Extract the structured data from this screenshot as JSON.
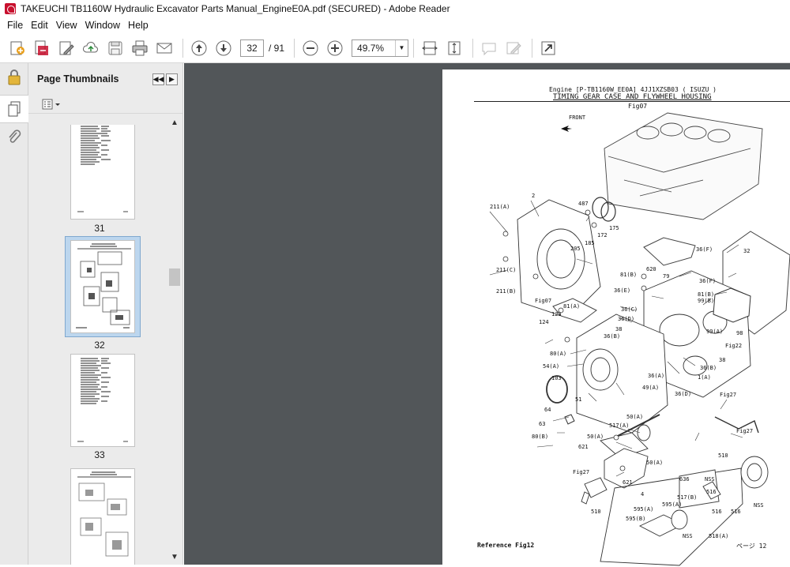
{
  "window": {
    "title": "TAKEUCHI TB1160W Hydraulic Excavator Parts Manual_EngineE0A.pdf (SECURED) - Adobe Reader",
    "app_icon": "adobe-reader-icon"
  },
  "menu": [
    "File",
    "Edit",
    "View",
    "Window",
    "Help"
  ],
  "toolbar": {
    "current_page": "32",
    "total_pages": "/ 91",
    "zoom": "49.7%"
  },
  "sidebar": {
    "panel_title": "Page Thumbnails",
    "thumbnails": [
      {
        "label": "31",
        "selected": false
      },
      {
        "label": "32",
        "selected": true
      },
      {
        "label": "33",
        "selected": false
      },
      {
        "label": "",
        "selected": false
      }
    ]
  },
  "document": {
    "header_line1": "Engine [P-TB1160W_EE0A]  4JJ1XZSB03 ( ISUZU )",
    "header_line2": "TIMING GEAR CASE AND FLYWHEEL HOUSING",
    "fig_ref": "Fig07",
    "front_label": "FRONT",
    "footer_left": "Reference  Fig12",
    "footer_right": "ページ  12",
    "callouts": [
      "2",
      "211(A)",
      "487",
      "175",
      "172",
      "185",
      "205",
      "211(C)",
      "211(B)",
      "Fig07",
      "620",
      "79",
      "36(F)",
      "32",
      "81(B)",
      "36(E)",
      "36(F)",
      "81(B)",
      "99(B)",
      "81(A)",
      "123",
      "124",
      "36(C)",
      "36(D)",
      "38",
      "36(B)",
      "99(A)",
      "98",
      "Fig22",
      "80(A)",
      "38",
      "54(A)",
      "36(B)",
      "103",
      "36(A)",
      "1(A)",
      "49(A)",
      "36(D)",
      "51",
      "Fig27",
      "64",
      "50(A)",
      "517(A)",
      "63",
      "50(A)",
      "Fig27",
      "80(B)",
      "621",
      "510",
      "50(A)",
      "636",
      "NSS",
      "Fig27",
      "621",
      "4",
      "517(B)",
      "516",
      "595(A)",
      "NSS",
      "595(A)",
      "510",
      "516",
      "516",
      "595(B)",
      "NSS",
      "518(A)"
    ]
  }
}
